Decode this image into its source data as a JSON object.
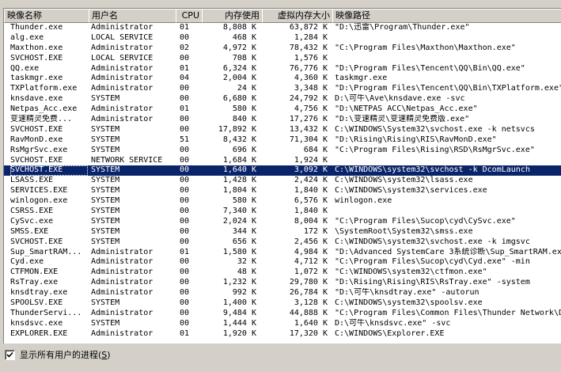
{
  "columns": {
    "name": "映像名称",
    "user": "用户名",
    "cpu": "CPU",
    "mem": "内存使用",
    "vm": "虚拟内存大小",
    "path": "映像路径"
  },
  "selected_index": 14,
  "rows": [
    {
      "name": "Thunder.exe",
      "user": "Administrator",
      "cpu": "01",
      "mem": "8,808 K",
      "vm": "63,872 K",
      "path": "\"D:\\迅雷\\Program\\Thunder.exe\""
    },
    {
      "name": "alg.exe",
      "user": "LOCAL SERVICE",
      "cpu": "00",
      "mem": "468 K",
      "vm": "1,284 K",
      "path": ""
    },
    {
      "name": "Maxthon.exe",
      "user": "Administrator",
      "cpu": "02",
      "mem": "4,972 K",
      "vm": "78,432 K",
      "path": "\"C:\\Program Files\\Maxthon\\Maxthon.exe\""
    },
    {
      "name": "SVCHOST.EXE",
      "user": "LOCAL SERVICE",
      "cpu": "00",
      "mem": "708 K",
      "vm": "1,576 K",
      "path": ""
    },
    {
      "name": "QQ.exe",
      "user": "Administrator",
      "cpu": "01",
      "mem": "6,324 K",
      "vm": "76,776 K",
      "path": "\"D:\\Program Files\\Tencent\\QQ\\Bin\\QQ.exe\""
    },
    {
      "name": "taskmgr.exe",
      "user": "Administrator",
      "cpu": "04",
      "mem": "2,004 K",
      "vm": "4,360 K",
      "path": "taskmgr.exe"
    },
    {
      "name": "TXPlatform.exe",
      "user": "Administrator",
      "cpu": "00",
      "mem": "24 K",
      "vm": "3,348 K",
      "path": "\"D:\\Program Files\\Tencent\\QQ\\Bin\\TXPlatform.exe\""
    },
    {
      "name": "knsdave.exe",
      "user": "SYSTEM",
      "cpu": "00",
      "mem": "6,680 K",
      "vm": "24,792 K",
      "path": "D:\\可牛\\Ave\\knsdave.exe -svc"
    },
    {
      "name": "Netpas_Acc.exe",
      "user": "Administrator",
      "cpu": "01",
      "mem": "580 K",
      "vm": "4,756 K",
      "path": "\"D:\\NETPAS ACC\\Netpas_Acc.exe\""
    },
    {
      "name": "变速精灵免费...",
      "user": "Administrator",
      "cpu": "00",
      "mem": "840 K",
      "vm": "17,276 K",
      "path": "\"D:\\变速精灵\\变速精灵免费版.exe\""
    },
    {
      "name": "SVCHOST.EXE",
      "user": "SYSTEM",
      "cpu": "00",
      "mem": "17,892 K",
      "vm": "13,432 K",
      "path": "C:\\WINDOWS\\System32\\svchost.exe -k netsvcs"
    },
    {
      "name": "RavMonD.exe",
      "user": "SYSTEM",
      "cpu": "51",
      "mem": "8,432 K",
      "vm": "71,304 K",
      "path": "\"D:\\Rising\\Rising\\RIS\\RavMonD.exe\""
    },
    {
      "name": "RsMgrSvc.exe",
      "user": "SYSTEM",
      "cpu": "00",
      "mem": "696 K",
      "vm": "684 K",
      "path": "\"C:\\Program Files\\Rising\\RSD\\RsMgrSvc.exe\""
    },
    {
      "name": "SVCHOST.EXE",
      "user": "NETWORK SERVICE",
      "cpu": "00",
      "mem": "1,684 K",
      "vm": "1,924 K",
      "path": ""
    },
    {
      "name": "SVCHOST.EXE",
      "user": "SYSTEM",
      "cpu": "00",
      "mem": "1,640 K",
      "vm": "3,092 K",
      "path": "C:\\WINDOWS\\system32\\svchost -k DcomLaunch"
    },
    {
      "name": "LSASS.EXE",
      "user": "SYSTEM",
      "cpu": "00",
      "mem": "1,428 K",
      "vm": "2,424 K",
      "path": "C:\\WINDOWS\\system32\\lsass.exe"
    },
    {
      "name": "SERVICES.EXE",
      "user": "SYSTEM",
      "cpu": "00",
      "mem": "1,804 K",
      "vm": "1,840 K",
      "path": "C:\\WINDOWS\\system32\\services.exe"
    },
    {
      "name": "winlogon.exe",
      "user": "SYSTEM",
      "cpu": "00",
      "mem": "580 K",
      "vm": "6,576 K",
      "path": "winlogon.exe"
    },
    {
      "name": "CSRSS.EXE",
      "user": "SYSTEM",
      "cpu": "00",
      "mem": "7,340 K",
      "vm": "1,840 K",
      "path": ""
    },
    {
      "name": "CySvc.exe",
      "user": "SYSTEM",
      "cpu": "00",
      "mem": "2,024 K",
      "vm": "8,004 K",
      "path": "\"C:\\Program Files\\Sucop\\cyd\\CySvc.exe\""
    },
    {
      "name": "SMSS.EXE",
      "user": "SYSTEM",
      "cpu": "00",
      "mem": "344 K",
      "vm": "172 K",
      "path": "\\SystemRoot\\System32\\smss.exe"
    },
    {
      "name": "SVCHOST.EXE",
      "user": "SYSTEM",
      "cpu": "00",
      "mem": "656 K",
      "vm": "2,456 K",
      "path": "C:\\WINDOWS\\system32\\svchost.exe -k imgsvc"
    },
    {
      "name": "Sup_SmartRAM...",
      "user": "Administrator",
      "cpu": "01",
      "mem": "1,580 K",
      "vm": "4,984 K",
      "path": "\"D:\\Advanced SystemCare 3系统诊断\\Sup_SmartRAM.exe\""
    },
    {
      "name": "Cyd.exe",
      "user": "Administrator",
      "cpu": "00",
      "mem": "32 K",
      "vm": "4,712 K",
      "path": "\"C:\\Program Files\\Sucop\\cyd\\Cyd.exe\" -min"
    },
    {
      "name": "CTFMON.EXE",
      "user": "Administrator",
      "cpu": "00",
      "mem": "48 K",
      "vm": "1,072 K",
      "path": "\"C:\\WINDOWS\\system32\\ctfmon.exe\""
    },
    {
      "name": "RsTray.exe",
      "user": "Administrator",
      "cpu": "00",
      "mem": "1,232 K",
      "vm": "29,780 K",
      "path": "\"D:\\Rising\\Rising\\RIS\\RsTray.exe\" -system"
    },
    {
      "name": "knsdtray.exe",
      "user": "Administrator",
      "cpu": "00",
      "mem": "992 K",
      "vm": "26,784 K",
      "path": "\"D:\\可牛\\knsdtray.exe\" -autorun"
    },
    {
      "name": "SPOOLSV.EXE",
      "user": "SYSTEM",
      "cpu": "00",
      "mem": "1,400 K",
      "vm": "3,128 K",
      "path": "C:\\WINDOWS\\system32\\spoolsv.exe"
    },
    {
      "name": "ThunderServi...",
      "user": "Administrator",
      "cpu": "00",
      "mem": "9,484 K",
      "vm": "44,888 K",
      "path": "\"C:\\Program Files\\Common Files\\Thunder Network\\D"
    },
    {
      "name": "knsdsvc.exe",
      "user": "SYSTEM",
      "cpu": "00",
      "mem": "1,444 K",
      "vm": "1,640 K",
      "path": "D:\\可牛\\knsdsvc.exe\" -svc"
    },
    {
      "name": "EXPLORER.EXE",
      "user": "Administrator",
      "cpu": "01",
      "mem": "1,920 K",
      "vm": "17,320 K",
      "path": "C:\\WINDOWS\\Explorer.EXE"
    }
  ],
  "footer": {
    "show_all_label": "显示所有用户的进程",
    "show_all_accel": "S",
    "show_all_checked": true
  }
}
